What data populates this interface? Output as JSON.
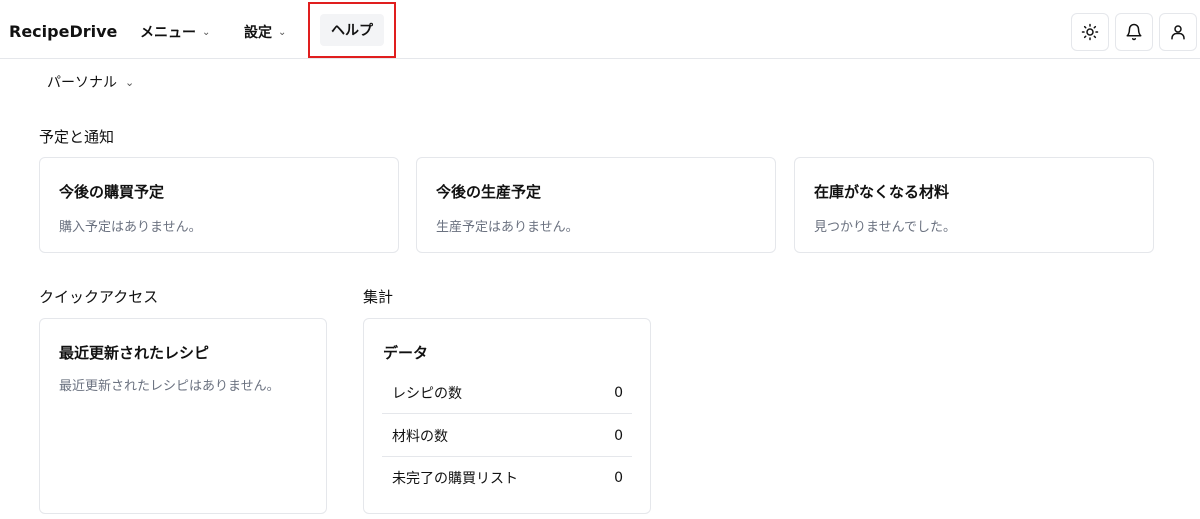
{
  "header": {
    "brand": "RecipeDrive",
    "menu_label": "メニュー",
    "settings_label": "設定",
    "help_label": "ヘルプ"
  },
  "personal": {
    "label": "パーソナル"
  },
  "sections": {
    "schedule_title": "予定と通知",
    "quick_access_title": "クイックアクセス",
    "summary_title": "集計"
  },
  "cards": {
    "purchase": {
      "title": "今後の購買予定",
      "desc": "購入予定はありません。"
    },
    "production": {
      "title": "今後の生産予定",
      "desc": "生産予定はありません。"
    },
    "stockout": {
      "title": "在庫がなくなる材料",
      "desc": "見つかりませんでした。"
    },
    "recent": {
      "title": "最近更新されたレシピ",
      "desc": "最近更新されたレシピはありません。"
    },
    "data": {
      "title": "データ",
      "rows": [
        {
          "label": "レシピの数",
          "value": "0"
        },
        {
          "label": "材料の数",
          "value": "0"
        },
        {
          "label": "未完了の購買リスト",
          "value": "0"
        }
      ]
    }
  },
  "colors": {
    "highlight": "#e01e1e",
    "border": "#e5e7eb",
    "muted": "#6b7280"
  },
  "icons": [
    "sun-icon",
    "bell-icon",
    "user-icon",
    "chevron-down-icon"
  ]
}
